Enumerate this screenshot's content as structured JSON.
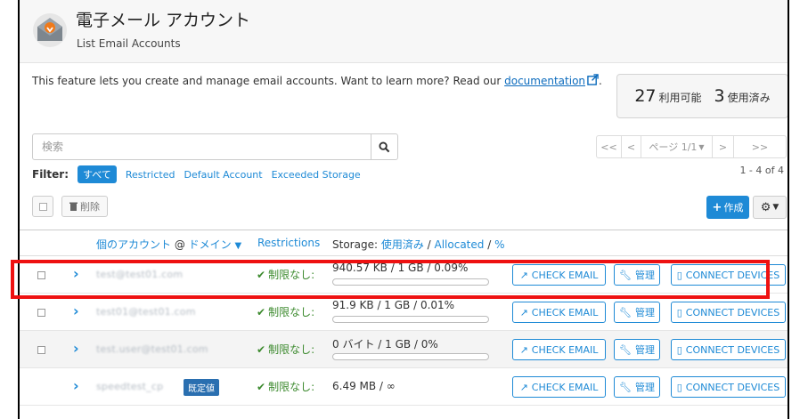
{
  "header": {
    "title": "電子メール アカウント",
    "subtitle": "List Email Accounts"
  },
  "description": {
    "text": "This feature lets you create and manage email accounts. Want to learn more? Read our ",
    "link": "documentation",
    "after": "."
  },
  "stats": {
    "available_count": "27",
    "available_label": "利用可能",
    "used_count": "3",
    "used_label": "使用済み"
  },
  "search": {
    "placeholder": "検索"
  },
  "pager": {
    "first": "<<",
    "prev": "<",
    "page": "ページ 1/1",
    "next": ">",
    "last": ">>"
  },
  "filter": {
    "label": "Filter:",
    "options": [
      "すべて",
      "Restricted",
      "Default Account",
      "Exceeded Storage"
    ]
  },
  "count": "1 - 4 of 4",
  "toolbar": {
    "delete_label": "削除",
    "create_label": "作成"
  },
  "table": {
    "col_account_prefix": "個のアカウント",
    "col_account_at": "@",
    "col_account_domain": "ドメイン",
    "col_restrictions": "Restrictions",
    "col_storage_label": "Storage:",
    "col_storage_used": "使用済み",
    "col_storage_allocated": "Allocated",
    "col_storage_pct": "%",
    "rows": [
      {
        "email": "test@test01.com",
        "restriction": "制限なし:",
        "storage": "940.57 KB / 1 GB / 0.09%",
        "usage_percent": 0.09,
        "badge": ""
      },
      {
        "email": "test01@test01.com",
        "restriction": "制限なし:",
        "storage": "91.9 KB / 1 GB / 0.01%",
        "usage_percent": 0.01,
        "badge": ""
      },
      {
        "email": "test.user@test01.com",
        "restriction": "制限なし:",
        "storage": "0 バイト / 1 GB / 0%",
        "usage_percent": 0,
        "badge": ""
      },
      {
        "email": "speedtest_cp",
        "restriction": "制限なし:",
        "storage": "6.49 MB / ∞",
        "usage_percent": null,
        "badge": "既定値"
      }
    ],
    "btn_check_email": "CHECK EMAIL",
    "btn_manage": "管理",
    "btn_connect": "CONNECT DEVICES"
  },
  "colors": {
    "accent": "#1e8ad6",
    "success": "#3c8a2e",
    "highlight": "#ee1111",
    "badge": "#2a6fb0"
  },
  "icons": {
    "header": "envelope-icon",
    "search": "search-icon",
    "external": "external-link-icon",
    "delete": "trash-icon",
    "create": "plus-icon",
    "settings": "gear-icon",
    "check": "checkmark-icon",
    "manage": "wrench-icon",
    "device": "phone-icon"
  }
}
